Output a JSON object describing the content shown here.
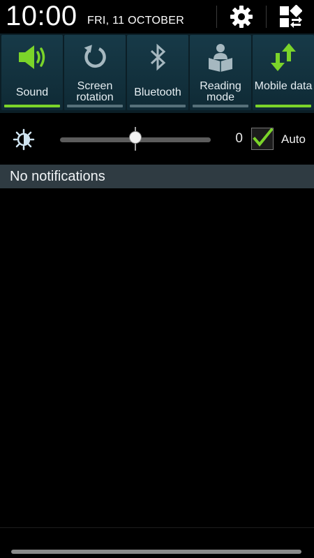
{
  "header": {
    "time": "10:00",
    "date": "FRI, 11 OCTOBER",
    "settings_icon": "gear-icon",
    "edit_icon": "grid-edit-icon"
  },
  "toggles": [
    {
      "id": "sound",
      "label": "Sound",
      "active": true,
      "icon": "speaker-icon"
    },
    {
      "id": "screen-rotation",
      "label": "Screen rotation",
      "active": false,
      "icon": "rotate-icon"
    },
    {
      "id": "bluetooth",
      "label": "Bluetooth",
      "active": false,
      "icon": "bluetooth-icon"
    },
    {
      "id": "reading-mode",
      "label": "Reading mode",
      "active": false,
      "icon": "reading-person-icon"
    },
    {
      "id": "mobile-data",
      "label": "Mobile data",
      "active": true,
      "icon": "data-arrows-icon"
    }
  ],
  "brightness": {
    "value": "0",
    "level_fraction": 0.5,
    "auto_label": "Auto",
    "auto_checked": true
  },
  "notifications": {
    "empty_text": "No notifications"
  },
  "colors": {
    "active_green": "#7bd42a",
    "inactive_bar": "#56707a",
    "tile_bg": "#173a48"
  }
}
